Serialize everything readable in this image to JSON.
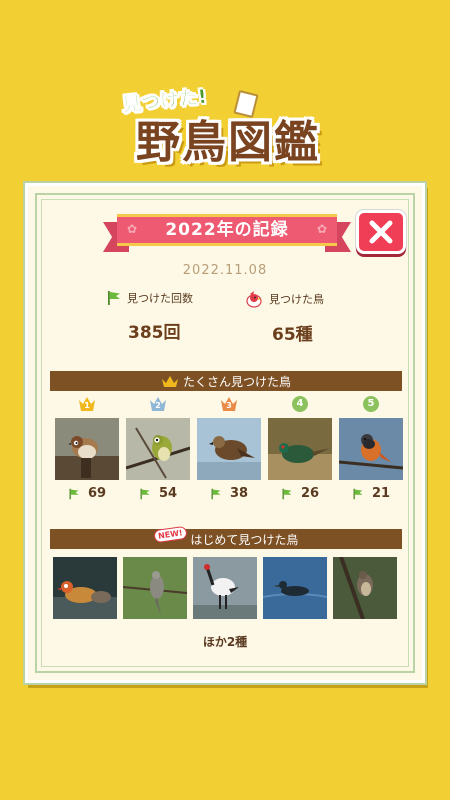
{
  "logo": {
    "subtitle": "見つけた!",
    "title": "野鳥図鑑"
  },
  "header": {
    "title": "2022年の記録",
    "close_icon": "close-icon"
  },
  "date": "2022.11.08",
  "stats": {
    "found_count_label": "見つけた回数",
    "found_count_value": "385回",
    "found_birds_label": "見つけた鳥",
    "found_birds_value": "65種"
  },
  "most_found": {
    "title": "たくさん見つけた鳥",
    "items": [
      {
        "rank": "1",
        "count": "69"
      },
      {
        "rank": "2",
        "count": "54"
      },
      {
        "rank": "3",
        "count": "38"
      },
      {
        "rank": "4",
        "count": "26"
      },
      {
        "rank": "5",
        "count": "21"
      }
    ]
  },
  "first_found": {
    "badge": "NEW!",
    "title": "はじめて見つけた鳥",
    "more": "ほか2種"
  },
  "colors": {
    "background": "#f2cf33",
    "ribbon": "#ef5a73",
    "close": "#ef3e55",
    "section_bar": "#7e5125",
    "gold": "#f0b81c",
    "silver": "#8fb7d6",
    "bronze": "#e98a48",
    "flag": "#6cba3c"
  }
}
